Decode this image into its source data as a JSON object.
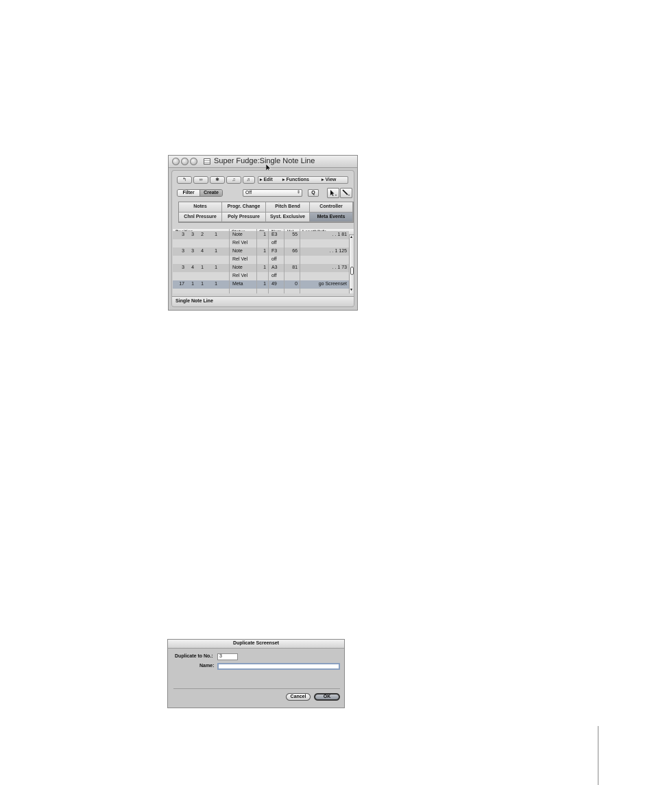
{
  "event_list_window": {
    "title": "Super Fudge:Single Note Line",
    "menus": [
      "Edit",
      "Functions",
      "View"
    ],
    "filter_label": "Filter",
    "create_label": "Create",
    "select_value": "Off",
    "q_label": "Q",
    "categories": [
      "Notes",
      "Progr. Change",
      "Pitch Bend",
      "Controller",
      "Chnl Pressure",
      "Poly Pressure",
      "Syst. Exclusive",
      "Meta Events"
    ],
    "columns": [
      "Position",
      "Status",
      "Ch",
      "Num",
      "Val",
      "Length/Info"
    ],
    "rows": [
      {
        "pos": [
          "3",
          "3",
          "2",
          "1"
        ],
        "status": "Note",
        "ch": "1",
        "num": "E3",
        "val": "55",
        "info": ". . 1 81"
      },
      {
        "pos": [
          "",
          "",
          "",
          ""
        ],
        "status": "Rel Vel",
        "ch": "",
        "num": "off",
        "val": "",
        "info": ""
      },
      {
        "pos": [
          "3",
          "3",
          "4",
          "1"
        ],
        "status": "Note",
        "ch": "1",
        "num": "F3",
        "val": "66",
        "info": ". . 1 125"
      },
      {
        "pos": [
          "",
          "",
          "",
          ""
        ],
        "status": "Rel Vel",
        "ch": "",
        "num": "off",
        "val": "",
        "info": ""
      },
      {
        "pos": [
          "3",
          "4",
          "1",
          "1"
        ],
        "status": "Note",
        "ch": "1",
        "num": "A3",
        "val": "81",
        "info": ". . 1 73"
      },
      {
        "pos": [
          "",
          "",
          "",
          ""
        ],
        "status": "Rel Vel",
        "ch": "",
        "num": "off",
        "val": "",
        "info": ""
      },
      {
        "pos": [
          "17",
          "1",
          "1",
          "1"
        ],
        "status": "Meta",
        "ch": "1",
        "num": "49",
        "val": "0",
        "info": "go Screenset"
      }
    ],
    "status_text": "Single Note Line"
  },
  "duplicate_dialog": {
    "title": "Duplicate Screenset",
    "duplicate_label": "Duplicate to No.:",
    "duplicate_value": "3",
    "name_label": "Name:",
    "name_value": "",
    "cancel_label": "Cancel",
    "ok_label": "OK"
  }
}
